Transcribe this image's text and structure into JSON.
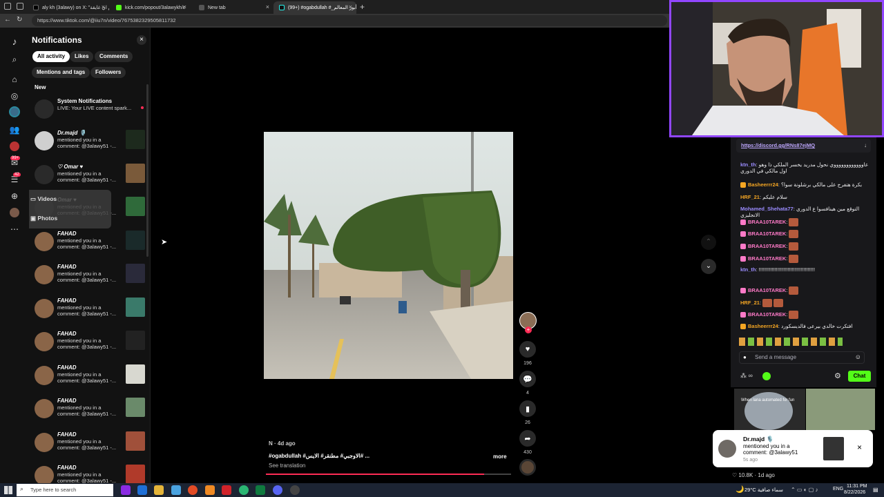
{
  "browser": {
    "tabs": [
      {
        "label": "aly kh (3alawy) on X: \"ام اي غايقة\""
      },
      {
        "label": "kick.com/popout/3alawykh/c"
      },
      {
        "label": "New tab"
      },
      {
        "label": "(99+) #ogabdullah #_أبوز المعالم"
      }
    ],
    "url": "https://www.tiktok.com/@iiu7n/video/7675382329505811732"
  },
  "rail": {
    "badge_99": "99+",
    "badge_42": "42"
  },
  "notifications": {
    "title": "Notifications",
    "close": "×",
    "filters": [
      "All activity",
      "Likes",
      "Comments"
    ],
    "filters2": [
      "Mentions and tags",
      "Followers"
    ],
    "section_new": "New",
    "system": {
      "name": "System Notifications",
      "text": "LIVE: Your LIVE content spark..."
    },
    "items": [
      {
        "name": "Dr.majd 🎙️",
        "line1": "mentioned you in a",
        "line2": "comment: @3alawy51 -..."
      },
      {
        "name": "♡ Omar ♥",
        "line1": "mentioned you in a",
        "line2": "comment: @3alawy51 -..."
      },
      {
        "name": "Omar ♥",
        "line1": "mentioned you in a",
        "line2": "comment: @3alawy51 -..."
      },
      {
        "name": "FAHAD",
        "line1": "mentioned you in a",
        "line2": "comment: @3alawy51 -..."
      },
      {
        "name": "FAHAD",
        "line1": "mentioned you in a",
        "line2": "comment: @3alawy51 -..."
      },
      {
        "name": "FAHAD",
        "line1": "mentioned you in a",
        "line2": "comment: @3alawy51 -..."
      },
      {
        "name": "FAHAD",
        "line1": "mentioned you in a",
        "line2": "comment: @3alawy51 -..."
      },
      {
        "name": "FAHAD",
        "line1": "mentioned you in a",
        "line2": "comment: @3alawy51 -..."
      },
      {
        "name": "FAHAD",
        "line1": "mentioned you in a",
        "line2": "comment: @3alawy51 -..."
      },
      {
        "name": "FAHAD",
        "line1": "mentioned you in a",
        "line2": "comment: @3alawy51 -..."
      },
      {
        "name": "FAHAD",
        "line1": "mentioned you in a",
        "line2": "comment: @3alawy51 -..."
      }
    ]
  },
  "upload_menu": {
    "videos": "Videos",
    "photos": "Photos"
  },
  "video": {
    "author": "N · 4d ago",
    "caption": "#ogabdullah #الاوجبي# مطنقر# الايس# ...",
    "more": "more",
    "see_translation": "See translation",
    "likes": "196",
    "comments": "4",
    "saves": "26",
    "shares": "430"
  },
  "chat": {
    "pinned": "https://discord.gg/RNs87ejMQ",
    "messages": [
      {
        "user": "ktn_th",
        "user_color": "#9b8cff",
        "text": "عاووووووووووووي نحول مدريد يخسر الملكي ذا وهو اول مالكي في الدوري"
      },
      {
        "user": "Basheerrr24",
        "user_color": "#f5a623",
        "text": "بكرة هتفرج على مالكي برشلونة سوا؟"
      },
      {
        "user": "HRF_21",
        "user_color": "#f5a623",
        "text": "سلام عليكم"
      },
      {
        "user": "Mohamed_Shehata77",
        "user_color": "#9b8cff",
        "text": "التوقع مين هينافسوا ع الدوري الانجليزي"
      },
      {
        "user": "BRAA10TAREK",
        "user_color": "#ff7ac8",
        "text": ""
      },
      {
        "user": "BRAA10TAREK",
        "user_color": "#ff7ac8",
        "text": ""
      },
      {
        "user": "BRAA10TAREK",
        "user_color": "#ff7ac8",
        "text": ""
      },
      {
        "user": "BRAA10TAREK",
        "user_color": "#ff7ac8",
        "text": ""
      },
      {
        "user": "ktn_th",
        "user_color": "#9b8cff",
        "text": "!!!!!!!!!!!!!!!!!!!!!!!!!!!!!!!!!!!!!!!"
      },
      {
        "user": "BRAA10TAREK",
        "user_color": "#ff7ac8",
        "text": ""
      },
      {
        "user": "HRF_21",
        "user_color": "#f5a623",
        "text": ""
      },
      {
        "user": "BRAA10TAREK",
        "user_color": "#ff7ac8",
        "text": ""
      },
      {
        "user": "Basheerrr24",
        "user_color": "#f5a623",
        "text": "افتكرت خالدي بيرعى فالديسكورد"
      }
    ],
    "placeholder": "Send a message",
    "chat_button": "Chat"
  },
  "toast": {
    "name": "Dr.majd 🎙️",
    "line1": "mentioned you in a",
    "line2": "comment: @3alawy51",
    "time": "5s ago"
  },
  "bottom_right": {
    "likes": "♡ 10.8K · 1d ago",
    "overlay": "When lana automated for fun"
  },
  "taskbar": {
    "search": "Type here to search",
    "weather": "29°C  سماء صافية",
    "lang": "ENG",
    "time": "11:31 PM",
    "date": "8/22/2026"
  },
  "colors": {
    "tiktok_red": "#fe2c55",
    "kick_green": "#53fc18",
    "twitch_purple": "#9146ff"
  }
}
